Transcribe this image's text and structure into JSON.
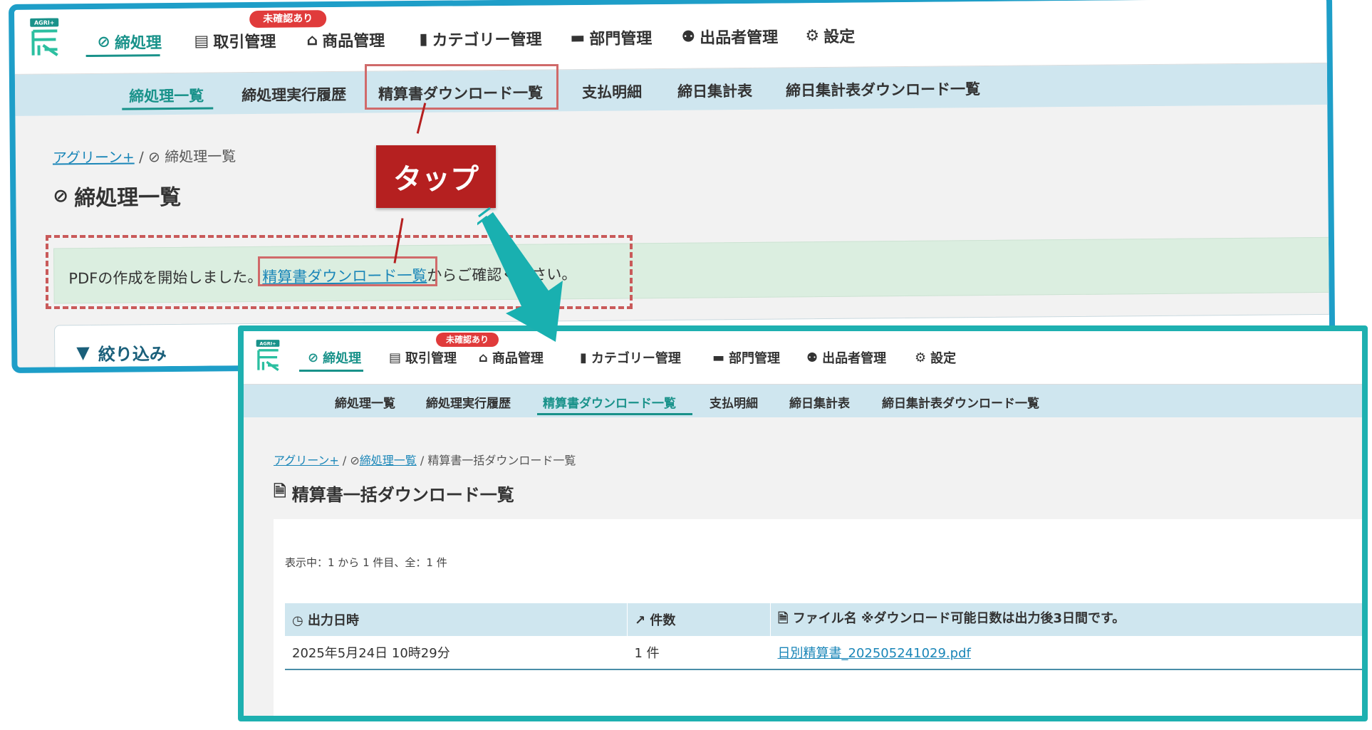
{
  "app": {
    "logo_text": "AGRI+",
    "nav": [
      {
        "label": "締処理",
        "icon": "check-circle-icon",
        "active": true
      },
      {
        "label": "取引管理",
        "icon": "document-icon"
      },
      {
        "label": "商品管理",
        "icon": "basket-icon"
      },
      {
        "label": "カテゴリー管理",
        "icon": "bookmark-icon"
      },
      {
        "label": "部門管理",
        "icon": "folder-icon"
      },
      {
        "label": "出品者管理",
        "icon": "users-icon"
      },
      {
        "label": "設定",
        "icon": "gear-icon"
      }
    ],
    "unconfirmed_badge": "未確認あり",
    "subnav": [
      "締処理一覧",
      "締処理実行履歴",
      "精算書ダウンロード一覧",
      "支払明細",
      "締日集計表",
      "締日集計表ダウンロード一覧"
    ]
  },
  "screen1": {
    "active_subnav": "締処理一覧",
    "breadcrumb": {
      "root": "アグリーン+",
      "sep": "/",
      "current": "締処理一覧"
    },
    "page_title": "締処理一覧",
    "alert": {
      "before": "PDFの作成を開始しました。",
      "link": "精算書ダウンロード一覧",
      "after": "からご確認ください。"
    },
    "filter_label": "絞り込み"
  },
  "callout": {
    "label": "タップ"
  },
  "screen2": {
    "active_subnav": "精算書ダウンロード一覧",
    "breadcrumb": {
      "root": "アグリーン+",
      "sep": "/",
      "middle": "締処理一覧",
      "current": "精算書一括ダウンロード一覧"
    },
    "page_title": "精算書一括ダウンロード一覧",
    "count_text": "表示中：1 から 1 件目、全：1 件",
    "table": {
      "headers": [
        {
          "label": "出力日時",
          "icon": "clock-icon"
        },
        {
          "label": "件数",
          "icon": "chart-line-icon"
        },
        {
          "label": "ファイル名 ※ダウンロード可能日数は出力後3日間です。",
          "icon": "file-icon"
        }
      ],
      "rows": [
        {
          "datetime": "2025年5月24日 10時29分",
          "count": "1 件",
          "file": "日別精算書_202505241029.pdf"
        }
      ]
    }
  },
  "colors": {
    "accent": "#19928a",
    "link": "#1a86b8",
    "alert_bg": "#dbeee0",
    "callout": "#b52020",
    "frame1": "#1e9ec8",
    "frame2": "#1eb0b0",
    "arrow": "#19b0b0"
  }
}
